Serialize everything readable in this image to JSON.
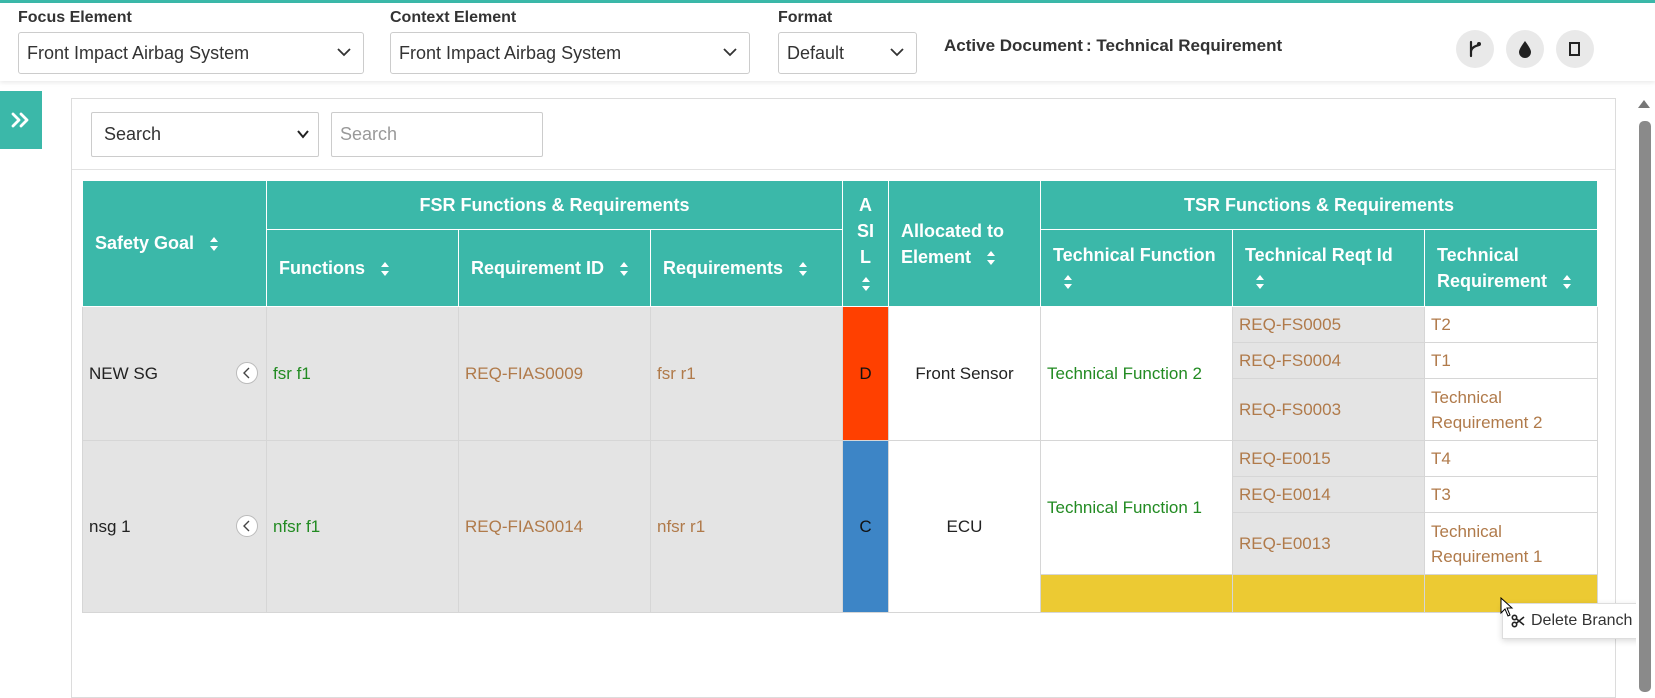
{
  "topbar": {
    "focus_label": "Focus Element",
    "focus_value": "Front Impact Airbag System",
    "context_label": "Context Element",
    "context_value": "Front Impact Airbag System",
    "format_label": "Format",
    "format_value": "Default",
    "active_doc_label": "Active Document",
    "active_doc_value": ": Technical Requirement"
  },
  "search": {
    "select_value": "Search",
    "placeholder": "Search"
  },
  "table": {
    "headers": {
      "safety_goal": "Safety Goal",
      "fsr_group": "FSR Functions & Requirements",
      "functions": "Functions",
      "requirement_id": "Requirement ID",
      "requirements": "Requirements",
      "asil_1": "A",
      "asil_2": "SI",
      "asil_3": "L",
      "allocated": "Allocated to Element",
      "tsr_group": "TSR Functions & Requirements",
      "tech_function": "Technical Function",
      "tech_reqt_id": "Technical Reqt Id",
      "tech_requirement": "Technical Requirement"
    },
    "rows": [
      {
        "safety_goal": "NEW SG",
        "function": "fsr f1",
        "requirement_id": "REQ-FIAS0009",
        "requirement": "fsr r1",
        "asil": "D",
        "asil_color": "#ff4000",
        "allocated": "Front Sensor",
        "tech_function": "Technical Function 2",
        "tsr": [
          {
            "id": "REQ-FS0005",
            "req": "T2"
          },
          {
            "id": "REQ-FS0004",
            "req": "T1"
          },
          {
            "id": "REQ-FS0003",
            "req": "Technical Requirement 2"
          }
        ]
      },
      {
        "safety_goal": "nsg 1",
        "function": "nfsr f1",
        "requirement_id": "REQ-FIAS0014",
        "requirement": "nfsr r1",
        "asil": "C",
        "asil_color": "#3d85c6",
        "allocated": "ECU",
        "tech_function": "Technical Function 1",
        "tsr": [
          {
            "id": "REQ-E0015",
            "req": "T4"
          },
          {
            "id": "REQ-E0014",
            "req": "T3"
          },
          {
            "id": "REQ-E0013",
            "req": "Technical Requirement 1"
          }
        ]
      }
    ]
  },
  "context_menu": {
    "delete_branch": "Delete Branch"
  },
  "colors": {
    "accent": "#3bb8a9",
    "highlight_row": "#ecca33"
  }
}
